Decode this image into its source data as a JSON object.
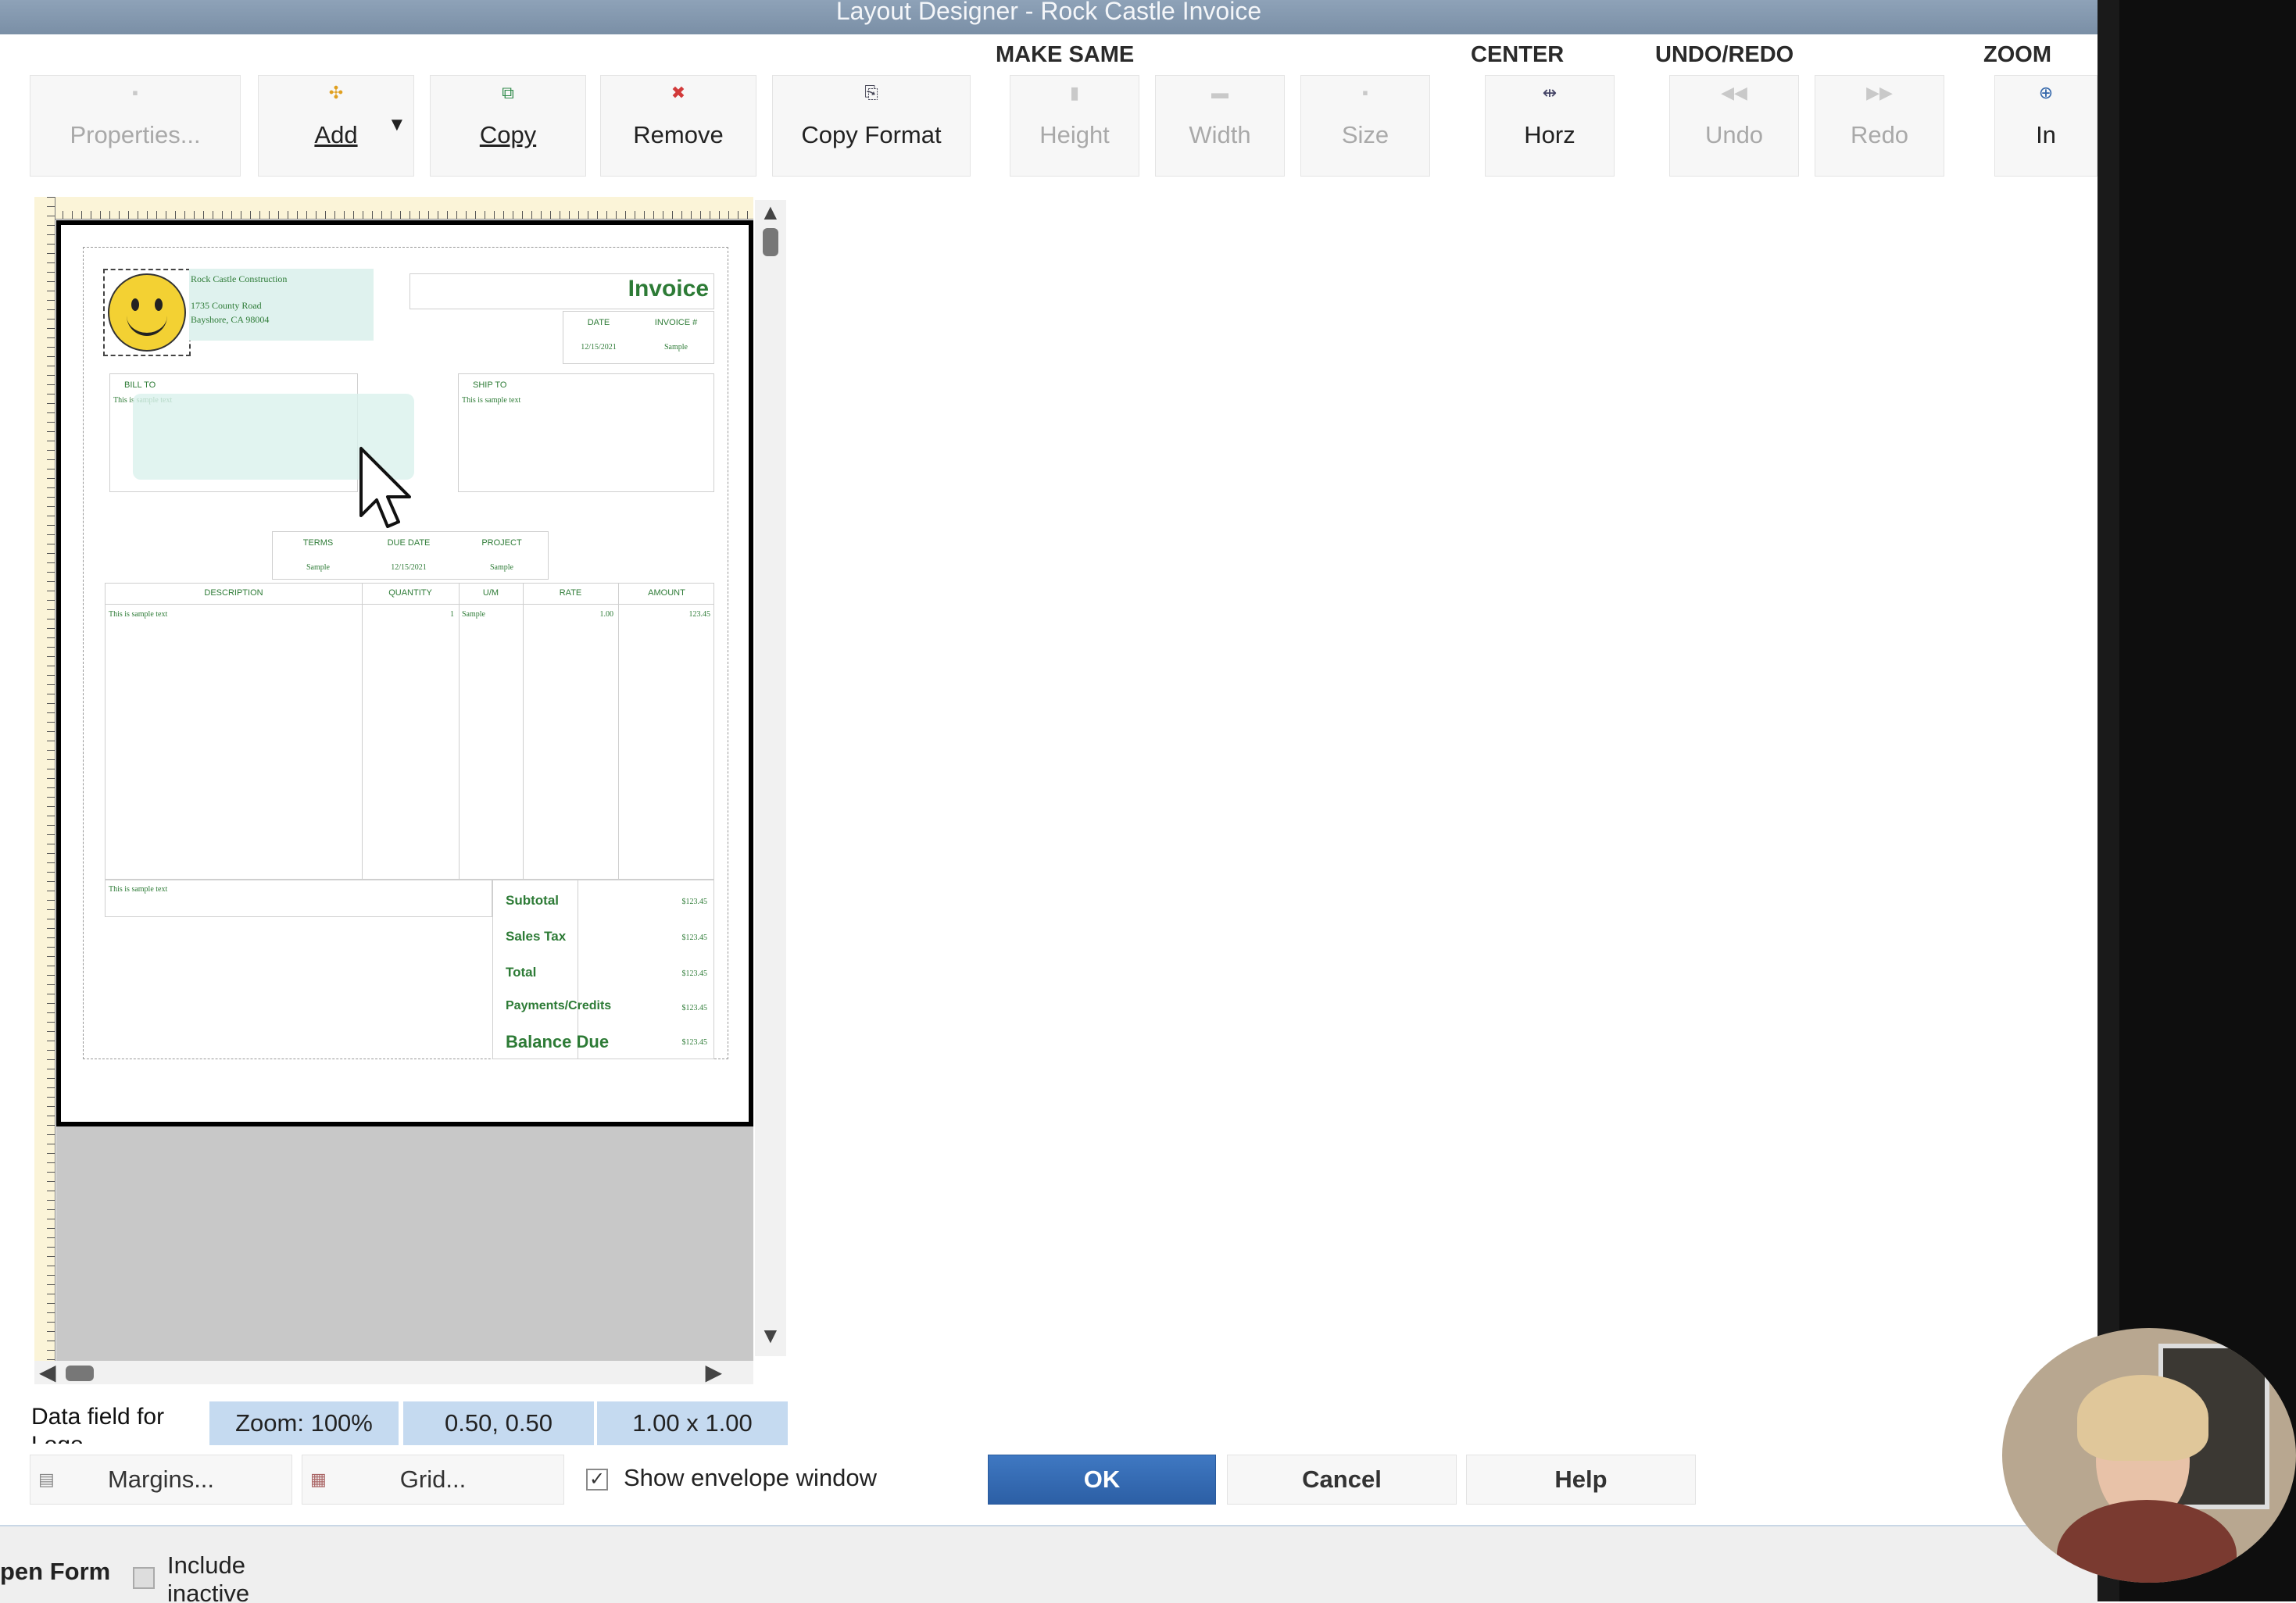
{
  "window": {
    "title": "Layout Designer - Rock Castle Invoice"
  },
  "toolbar": {
    "groups": {
      "make_same": "MAKE SAME",
      "center": "CENTER",
      "undo_redo": "UNDO/REDO",
      "zoom": "ZOOM"
    },
    "properties_label": "Properties...",
    "add_label": "Add",
    "copy_label": "Copy",
    "remove_label": "Remove",
    "copy_format_label": "Copy Format",
    "height_label": "Height",
    "width_label": "Width",
    "size_label": "Size",
    "horz_label": "Horz",
    "undo_label": "Undo",
    "redo_label": "Redo",
    "zoom_in_label": "In"
  },
  "form": {
    "company_name": "Rock Castle Construction",
    "address1": "1735 County Road",
    "address2": "Bayshore, CA 98004",
    "title": "Invoice",
    "date_hdr": "DATE",
    "invoice_hdr": "INVOICE #",
    "date_val": "12/15/2021",
    "invoice_val": "Sample",
    "bill_to": "BILL TO",
    "ship_to": "SHIP TO",
    "sample_text": "This is sample text",
    "terms_hdr": "TERMS",
    "due_hdr": "DUE DATE",
    "project_hdr": "PROJECT",
    "terms_val": "Sample",
    "due_val": "12/15/2021",
    "project_val": "Sample",
    "col_desc": "DESCRIPTION",
    "col_qty": "QUANTITY",
    "col_um": "U/M",
    "col_rate": "RATE",
    "col_amount": "AMOUNT",
    "row_desc": "This is sample text",
    "row_qty": "1",
    "row_um": "Sample",
    "row_rate": "1.00",
    "row_amount": "123.45",
    "memo": "This is sample text",
    "subtotal": "Subtotal",
    "sales_tax": "Sales Tax",
    "total": "Total",
    "payments": "Payments/Credits",
    "balance": "Balance Due",
    "money": "$123.45"
  },
  "status": {
    "field_label": "Data field for Logo",
    "zoom": "Zoom: 100%",
    "position": "0.50, 0.50",
    "size": "1.00 x 1.00"
  },
  "buttons": {
    "margins": "Margins...",
    "grid": "Grid...",
    "envelope": "Show envelope window",
    "ok": "OK",
    "cancel": "Cancel",
    "help": "Help"
  },
  "bottom": {
    "open_form": "pen Form",
    "include_inactive": "Include inactive"
  }
}
